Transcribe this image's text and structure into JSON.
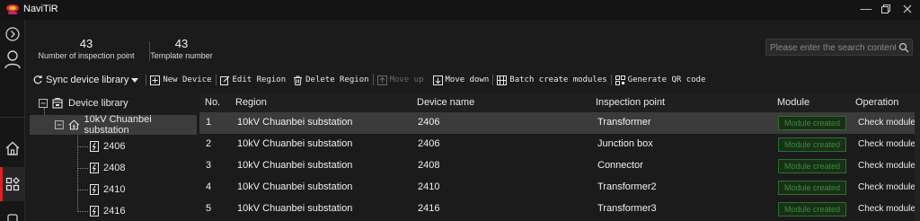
{
  "app": {
    "title": "NaviTiR"
  },
  "stats": [
    {
      "value": "43",
      "label": "Number of inspection point"
    },
    {
      "value": "43",
      "label": "Template number"
    }
  ],
  "search": {
    "placeholder": "Please enter the search content"
  },
  "toolbar": {
    "sync": "Sync device library",
    "new_device": "New Device",
    "edit_region": "Edit Region",
    "delete_region": "Delete Region",
    "move_up": "Move up",
    "move_down": "Move down",
    "batch_create": "Batch create modules",
    "generate_qr": "Generate QR code"
  },
  "tree": {
    "root": "Device library",
    "substation": "10kV Chuanbei substation",
    "devices": [
      "2406",
      "2408",
      "2410",
      "2416"
    ]
  },
  "table": {
    "columns": [
      "No.",
      "Region",
      "Device name",
      "Inspection point",
      "Module",
      "Operation"
    ],
    "rows": [
      {
        "no": "1",
        "region": "10kV Chuanbei substation",
        "device": "2406",
        "point": "Transformer",
        "module": "Module created",
        "operation": "Check module"
      },
      {
        "no": "2",
        "region": "10kV Chuanbei substation",
        "device": "2406",
        "point": "Junction box",
        "module": "Module created",
        "operation": "Check module"
      },
      {
        "no": "3",
        "region": "10kV Chuanbei substation",
        "device": "2408",
        "point": "Connector",
        "module": "Module created",
        "operation": "Check module"
      },
      {
        "no": "4",
        "region": "10kV Chuanbei substation",
        "device": "2410",
        "point": "Transformer2",
        "module": "Module created",
        "operation": "Check module"
      },
      {
        "no": "5",
        "region": "10kV Chuanbei substation",
        "device": "2416",
        "point": "Transformer3",
        "module": "Module created",
        "operation": "Check module"
      }
    ]
  },
  "colors": {
    "accent": "#e02020",
    "module_green": "#3c8a3c",
    "background": "#1b1b1b"
  }
}
